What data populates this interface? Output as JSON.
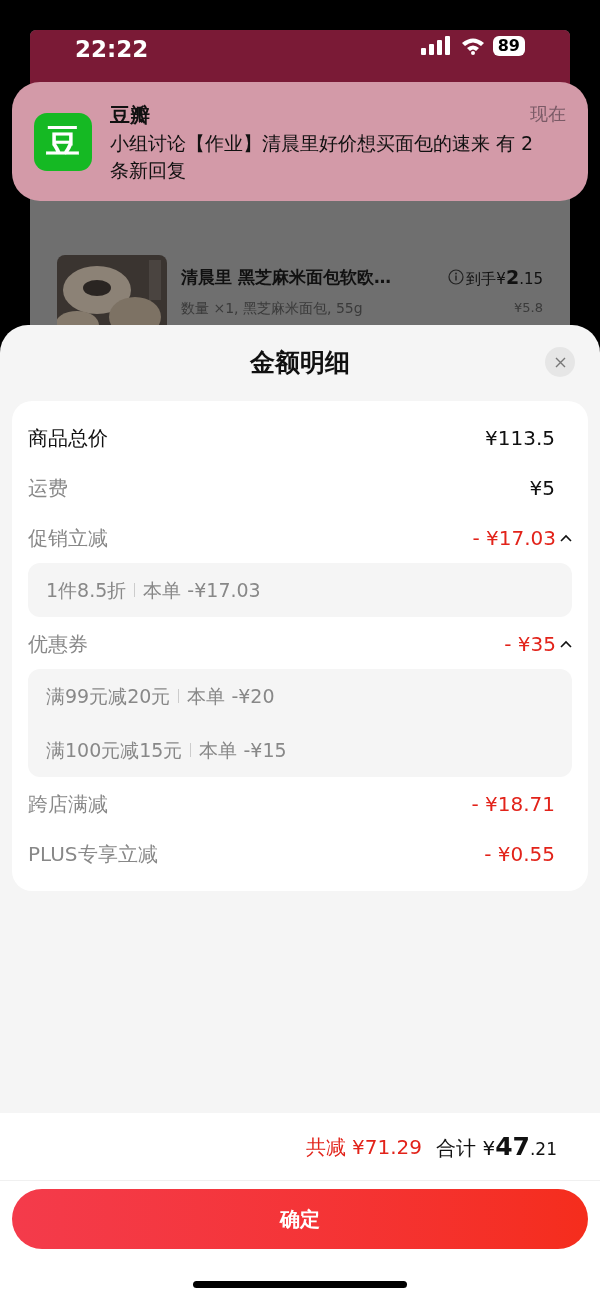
{
  "status_bar": {
    "time": "22:22",
    "battery": "89"
  },
  "notification": {
    "app": "豆瓣",
    "icon_glyph": "豆",
    "time": "现在",
    "message": "小组讨论【作业】清晨里好价想买面包的速来 有 2 条新回复"
  },
  "background_product": {
    "title": "清晨里 黑芝麻米面包软欧…",
    "spec": "数量 ×1, 黑芝麻米面包, 55g",
    "final_label": "到手",
    "final_currency": "¥",
    "final_int": "2",
    "final_dec": ".15",
    "price": "¥5.8"
  },
  "sheet": {
    "title": "金额明细",
    "rows": [
      {
        "kind": "total",
        "label": "商品总价",
        "value": "¥113.5"
      },
      {
        "kind": "fee",
        "label": "运费",
        "value": "¥5"
      },
      {
        "kind": "discount",
        "label": "促销立减",
        "value": "- ¥17.03",
        "expanded": true,
        "details": [
          {
            "name": "1件8.5折",
            "amount": "本单 -¥17.03"
          }
        ]
      },
      {
        "kind": "discount",
        "label": "优惠券",
        "value": "- ¥35",
        "expanded": true,
        "details": [
          {
            "name": "满99元减20元",
            "amount": "本单 -¥20"
          },
          {
            "name": "满100元减15元",
            "amount": "本单 -¥15"
          }
        ]
      },
      {
        "kind": "discount",
        "label": "跨店满减",
        "value": "- ¥18.71"
      },
      {
        "kind": "discount",
        "label": "PLUS专享立减",
        "value": "- ¥0.55"
      }
    ]
  },
  "footer": {
    "saved_label": "共减",
    "saved_value": "¥71.29",
    "total_label": "合计",
    "total_currency": "¥",
    "total_int": "47",
    "total_dec": ".21",
    "confirm": "确定"
  }
}
